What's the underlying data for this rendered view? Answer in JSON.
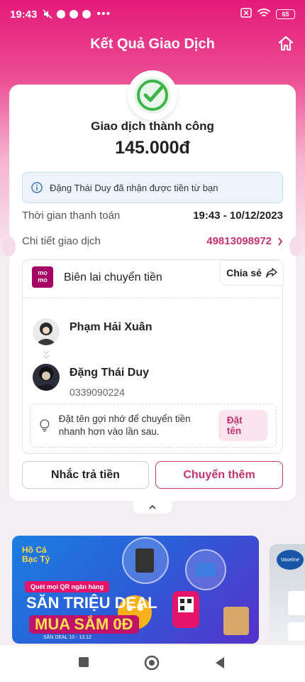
{
  "status_bar": {
    "time": "19:43",
    "more": "•••",
    "battery": "65",
    "icons": [
      "no-sound-icon",
      "messenger-icon",
      "messenger-icon",
      "app-icon",
      "sim-off-icon",
      "wifi-icon",
      "battery-icon"
    ]
  },
  "header": {
    "title": "Kết Quả Giao Dịch",
    "home_icon": "home-icon"
  },
  "result": {
    "title": "Giao dịch thành công",
    "amount": "145.000đ",
    "info_message": "Đặng Thái Duy đã nhận được tiền từ bạn"
  },
  "details": {
    "payment_time_label": "Thời gian thanh toán",
    "payment_time_value": "19:43 - 10/12/2023",
    "transaction_label": "Chi tiết giao dịch",
    "transaction_id": "49813098972"
  },
  "receipt": {
    "logo_text_top": "mo",
    "logo_text_bottom": "mo",
    "title": "Biên lai chuyển tiền",
    "share_label": "Chia sẻ",
    "sender_name": "Phạm Hải Xuân",
    "receiver_name": "Đặng Thái Duy",
    "receiver_phone": "0339090224",
    "suggest_text": "Đặt tên gợi nhớ để chuyển tiền nhanh hơn vào lần sau.",
    "suggest_button": "Đặt tên"
  },
  "actions": {
    "remind_label": "Nhắc trả tiền",
    "transfer_more_label": "Chuyển thêm"
  },
  "banner": {
    "brand_line1": "Hồ Cá",
    "brand_line2": "Bạc Tỷ",
    "subtitle": "Quét mọi QR ngân hàng",
    "line1": "SĂN TRIỆU DEAL",
    "line2": "MUA SẮM 0Đ",
    "date_text": "SĂN DEAL 10 - 13.12"
  },
  "banner2": {
    "logo": "Vaseline"
  },
  "colors": {
    "brand_pink": "#c2346f",
    "header_gradient_top": "#e4197a",
    "success_green": "#3cb64a",
    "momo": "#a50064"
  }
}
